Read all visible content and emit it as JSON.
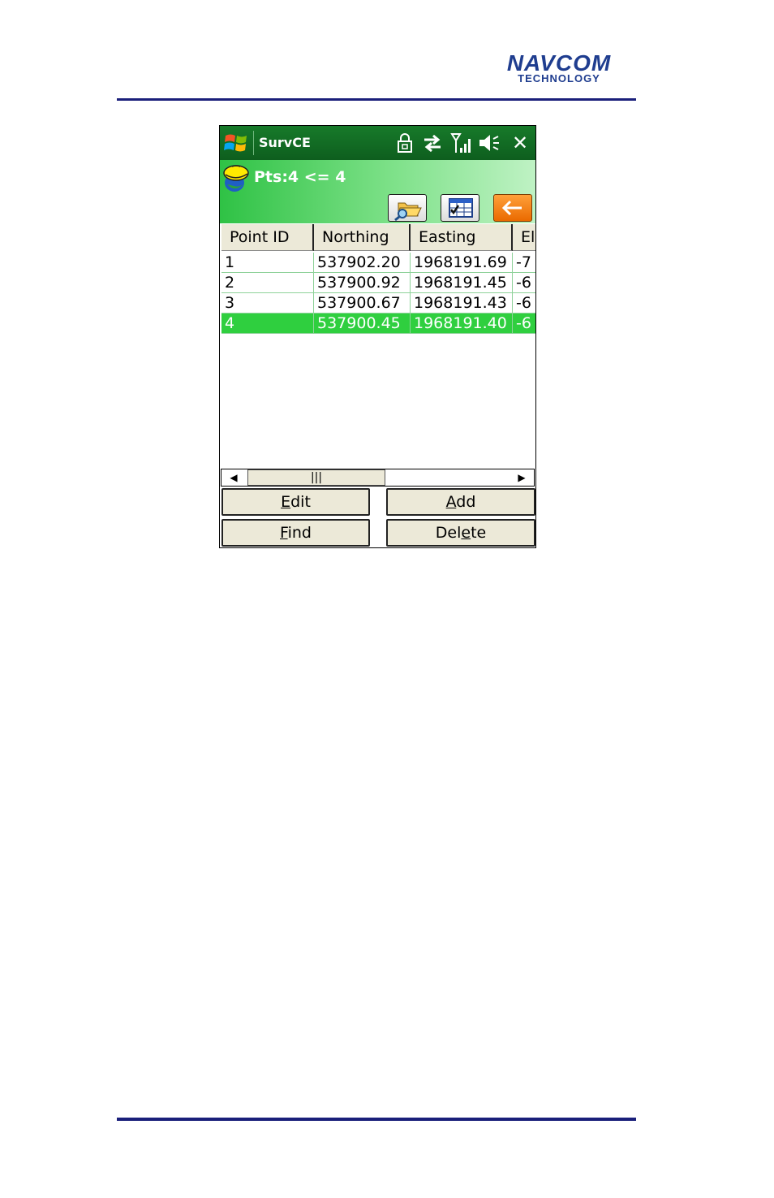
{
  "page": {
    "logo": {
      "line1": "NAVCOM",
      "line2": "TECHNOLOGY"
    }
  },
  "titlebar": {
    "app_title": "SurvCE",
    "close_label": "✕"
  },
  "header": {
    "title": "Pts:4 <= 4"
  },
  "table": {
    "columns": [
      "Point ID",
      "Northing",
      "Easting",
      "El"
    ],
    "rows": [
      [
        "1",
        "537902.20",
        "1968191.69",
        "-7"
      ],
      [
        "2",
        "537900.92",
        "1968191.45",
        "-6"
      ],
      [
        "3",
        "537900.67",
        "1968191.43",
        "-6"
      ],
      [
        "4",
        "537900.45",
        "1968191.40",
        "-6"
      ]
    ],
    "selected_row": 4
  },
  "scrollbar": {
    "left_arrow": "◀",
    "right_arrow": "▶",
    "thumb_grip": "|||"
  },
  "buttons": {
    "edit": {
      "mnemonic": "E",
      "rest": "dit"
    },
    "add": {
      "mnemonic": "A",
      "rest": "dd"
    },
    "find": {
      "mnemonic": "F",
      "rest": "ind"
    },
    "delete": {
      "pre": "Del",
      "mnemonic": "e",
      "rest": "te"
    }
  },
  "colors": {
    "titlebar": "#0e5e1e",
    "selection": "#2fcf3f",
    "accent_orange": "#ea6a00",
    "rule": "#1a1f7a"
  },
  "icons": [
    "windows-start-icon",
    "lock-icon",
    "sync-arrows-icon",
    "signal-icon",
    "speaker-muted-icon",
    "survce-helmet-icon",
    "open-folder-icon",
    "table-view-icon",
    "back-arrow-icon"
  ]
}
